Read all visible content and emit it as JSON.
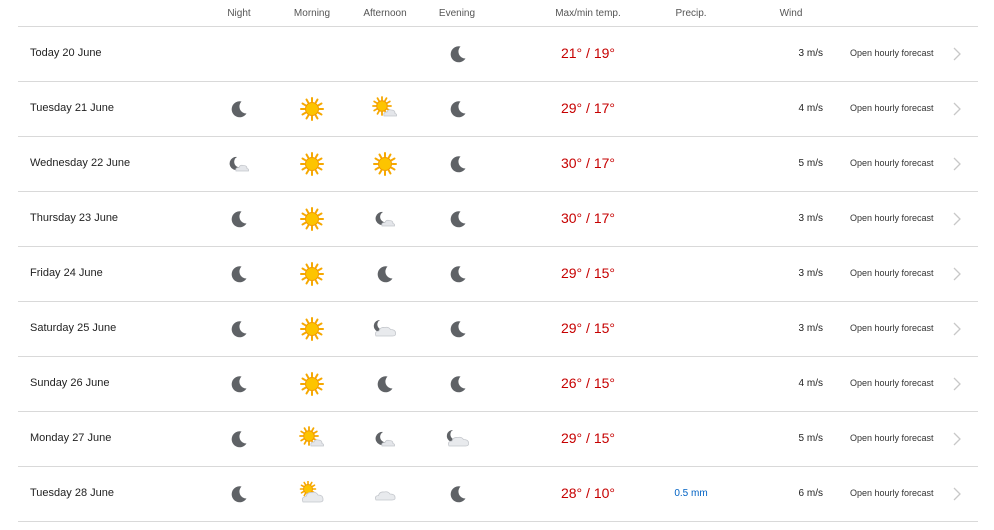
{
  "header": {
    "night": "Night",
    "morning": "Morning",
    "afternoon": "Afternoon",
    "evening": "Evening",
    "temp": "Max/min temp.",
    "precip": "Precip.",
    "wind": "Wind"
  },
  "rows": [
    {
      "day": "Today 20 June",
      "icons": [
        "",
        "",
        "",
        "moon-icon"
      ],
      "temp": "21° / 19°",
      "precip": "",
      "wind": "3 m/s",
      "link": "Open hourly forecast"
    },
    {
      "day": "Tuesday 21 June",
      "icons": [
        "moon-icon",
        "sun-icon",
        "sun-cloud-icon",
        "moon-icon"
      ],
      "temp": "29° / 17°",
      "precip": "",
      "wind": "4 m/s",
      "link": "Open hourly forecast"
    },
    {
      "day": "Wednesday 22 June",
      "icons": [
        "moon-cloud-icon",
        "sun-icon",
        "sun-icon",
        "moon-icon"
      ],
      "temp": "30° / 17°",
      "precip": "",
      "wind": "5 m/s",
      "link": "Open hourly forecast"
    },
    {
      "day": "Thursday 23 June",
      "icons": [
        "moon-icon",
        "sun-icon",
        "moon-cloud-icon",
        "moon-icon"
      ],
      "temp": "30° / 17°",
      "precip": "",
      "wind": "3 m/s",
      "link": "Open hourly forecast"
    },
    {
      "day": "Friday 24 June",
      "icons": [
        "moon-icon",
        "sun-icon",
        "moon-icon",
        "moon-icon"
      ],
      "temp": "29° / 15°",
      "precip": "",
      "wind": "3 m/s",
      "link": "Open hourly forecast"
    },
    {
      "day": "Saturday 25 June",
      "icons": [
        "moon-icon",
        "sun-icon",
        "moon-big-cloud-icon",
        "moon-icon"
      ],
      "temp": "29° / 15°",
      "precip": "",
      "wind": "3 m/s",
      "link": "Open hourly forecast"
    },
    {
      "day": "Sunday 26 June",
      "icons": [
        "moon-icon",
        "sun-icon",
        "moon-icon",
        "moon-icon"
      ],
      "temp": "26° / 15°",
      "precip": "",
      "wind": "4 m/s",
      "link": "Open hourly forecast"
    },
    {
      "day": "Monday 27 June",
      "icons": [
        "moon-icon",
        "sun-cloud-icon",
        "moon-cloud-icon",
        "moon-big-cloud-icon"
      ],
      "temp": "29° / 15°",
      "precip": "",
      "wind": "5 m/s",
      "link": "Open hourly forecast"
    },
    {
      "day": "Tuesday 28 June",
      "icons": [
        "moon-icon",
        "sun-big-cloud-icon",
        "cloud-icon",
        "moon-icon"
      ],
      "temp": "28° / 10°",
      "precip": "0.5 mm",
      "wind": "6 m/s",
      "link": "Open hourly forecast"
    }
  ]
}
